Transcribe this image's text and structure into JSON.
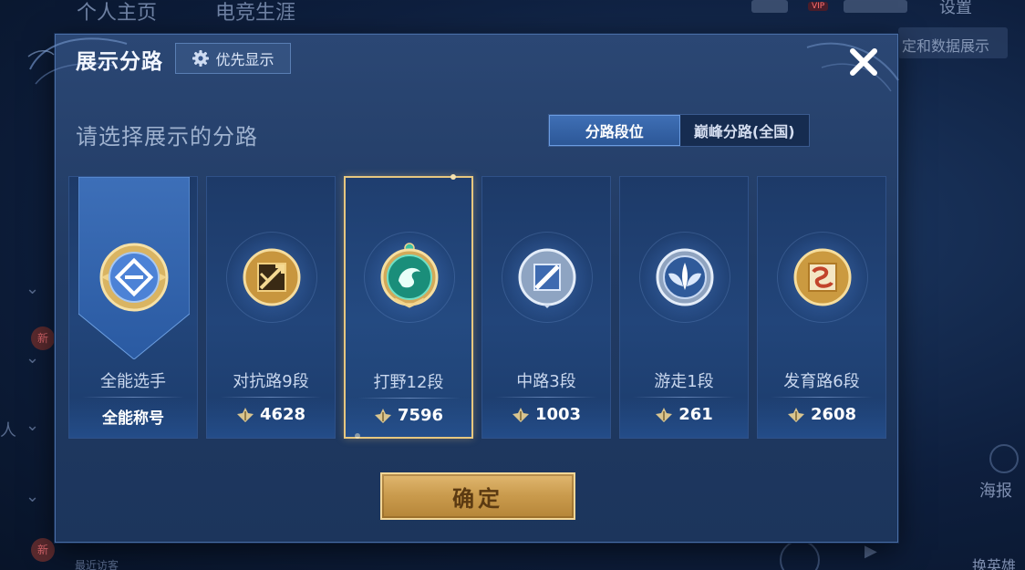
{
  "background": {
    "tabs": [
      "个人主页",
      "电竞生涯"
    ],
    "vip": "VIP",
    "settings": "设置",
    "right_button": "定和数据展示",
    "side_new_badge": "新",
    "side_person": "人",
    "poster": "海报",
    "change_hero": "换英雄",
    "recent": "最近访客"
  },
  "dialog": {
    "title": "展示分路",
    "priority_button": "优先显示",
    "subtitle": "请选择展示的分路",
    "segments": [
      {
        "label": "分路段位",
        "active": true
      },
      {
        "label": "巅峰分路(全国)",
        "active": false
      }
    ],
    "cards": [
      {
        "name": "全能选手",
        "stat": "全能称号",
        "badge": "all-round-emblem-icon",
        "selected": false
      },
      {
        "name": "对抗路9段",
        "stat": "4628",
        "badge": "clash-lane-emblem-icon",
        "selected": false
      },
      {
        "name": "打野12段",
        "stat": "7596",
        "badge": "jungle-emblem-icon",
        "selected": true
      },
      {
        "name": "中路3段",
        "stat": "1003",
        "badge": "mid-lane-emblem-icon",
        "selected": false
      },
      {
        "name": "游走1段",
        "stat": "261",
        "badge": "roam-emblem-icon",
        "selected": false
      },
      {
        "name": "发育路6段",
        "stat": "2608",
        "badge": "farm-lane-emblem-icon",
        "selected": false
      }
    ],
    "confirm": "确定"
  },
  "colors": {
    "gold": "#e7c77f",
    "active_tab": "#3f6fb5",
    "panel": "#213b64"
  }
}
